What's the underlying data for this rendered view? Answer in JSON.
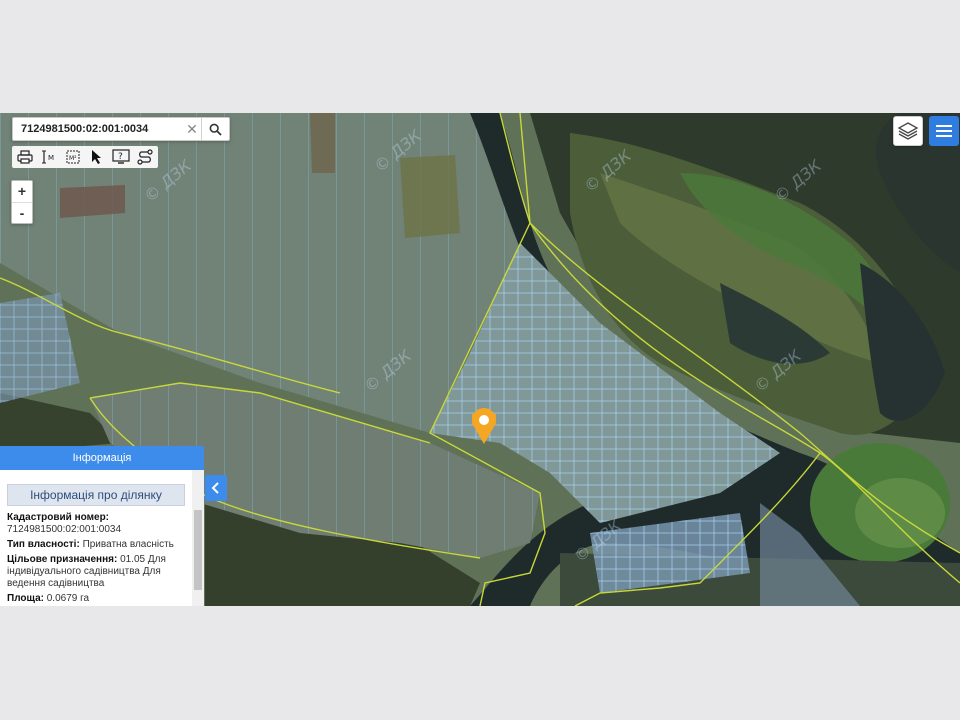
{
  "search": {
    "value": "7124981500:02:001:0034"
  },
  "toolbar": {
    "items": [
      "print-icon",
      "measure-distance-icon",
      "measure-area-icon",
      "pointer-icon",
      "help-info-icon",
      "route-icon"
    ]
  },
  "zoom": {
    "in_label": "+",
    "out_label": "-"
  },
  "map": {
    "watermark": "© ДЗК"
  },
  "panel": {
    "header": "Інформація",
    "title": "Інформація про ділянку",
    "rows": [
      {
        "label": "Кадастровий номер:",
        "value": "7124981500:02:001:0034"
      },
      {
        "label": "Тип власності:",
        "value": "Приватна власність"
      },
      {
        "label": "Цільове призначення:",
        "value": "01.05 Для індивідуального садівництва Для ведення садівництва"
      },
      {
        "label": "Площа:",
        "value": "0.0679 га"
      }
    ]
  },
  "colors": {
    "accent": "#3d8bea",
    "marker": "#f5a623",
    "parcel_stroke": "#9cc9f2",
    "boundary": "#c8d83a"
  }
}
